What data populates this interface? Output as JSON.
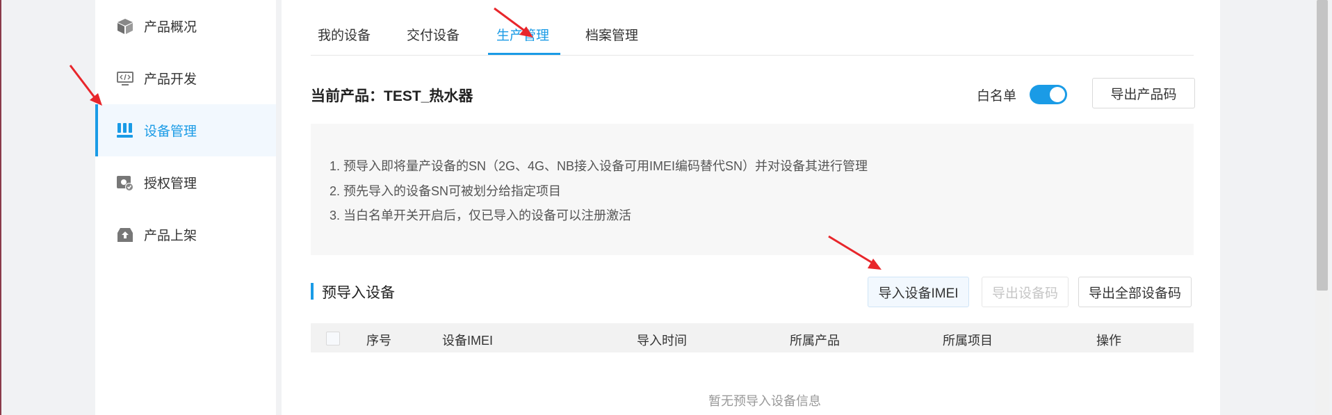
{
  "sidebar": {
    "items": [
      {
        "label": "产品概况",
        "icon": "cube-icon"
      },
      {
        "label": "产品开发",
        "icon": "code-monitor-icon"
      },
      {
        "label": "设备管理",
        "icon": "device-grid-icon"
      },
      {
        "label": "授权管理",
        "icon": "auth-gear-icon"
      },
      {
        "label": "产品上架",
        "icon": "upload-tray-icon"
      }
    ],
    "active_index": 2
  },
  "tabs": [
    {
      "label": "我的设备"
    },
    {
      "label": "交付设备"
    },
    {
      "label": "生产管理"
    },
    {
      "label": "档案管理"
    }
  ],
  "active_tab": 2,
  "header": {
    "current_product": "当前产品：TEST_热水器",
    "whitelist_label": "白名单",
    "whitelist_on": true,
    "export_product_code": "导出产品码"
  },
  "notice": {
    "lines": [
      "1. 预导入即将量产设备的SN（2G、4G、NB接入设备可用IMEI编码替代SN）并对设备其进行管理",
      "2. 预先导入的设备SN可被划分给指定项目",
      "3. 当白名单开关开启后，仅已导入的设备可以注册激活"
    ]
  },
  "section": {
    "title": "预导入设备",
    "import_button": "导入设备IMEI",
    "export_code_button": "导出设备码",
    "export_all_button": "导出全部设备码"
  },
  "table": {
    "columns": [
      "序号",
      "设备IMEI",
      "导入时间",
      "所属产品",
      "所属项目",
      "操作"
    ],
    "empty_text": "暂无预导入设备信息"
  },
  "colors": {
    "accent": "#1a9be6",
    "arrow": "#e8262b"
  }
}
